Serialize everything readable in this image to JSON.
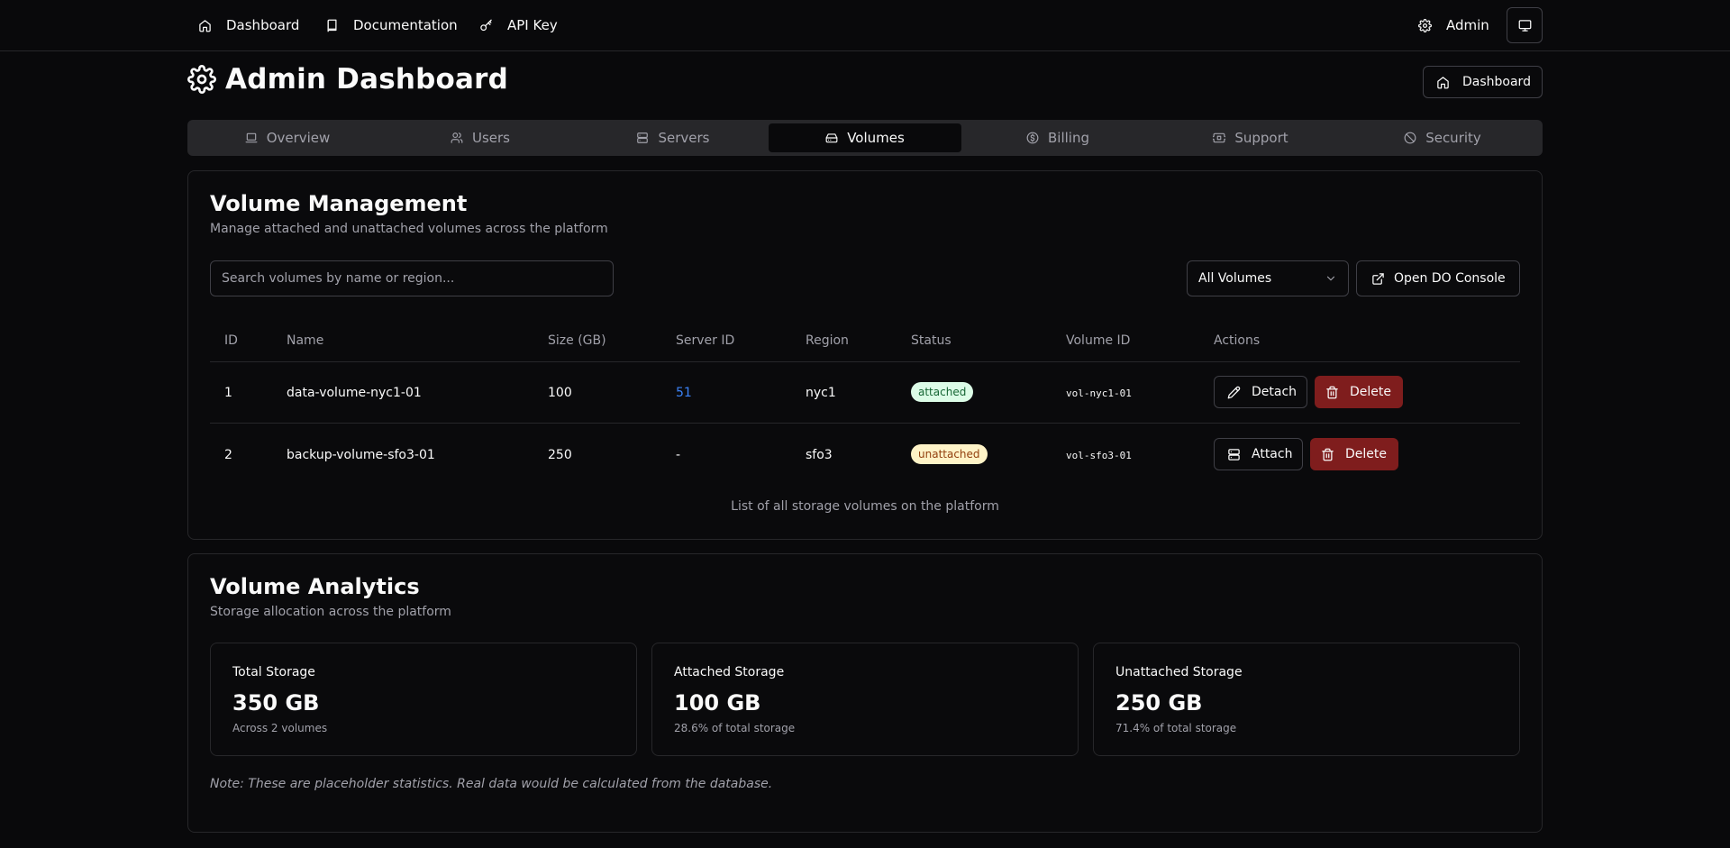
{
  "topnav": {
    "dashboard": "Dashboard",
    "documentation": "Documentation",
    "api_key": "API Key",
    "admin": "Admin"
  },
  "header": {
    "title": "Admin Dashboard",
    "dashboard_button": "Dashboard"
  },
  "tabs": [
    {
      "label": "Overview",
      "icon": "laptop-icon"
    },
    {
      "label": "Users",
      "icon": "users-icon"
    },
    {
      "label": "Servers",
      "icon": "server-icon"
    },
    {
      "label": "Volumes",
      "icon": "hard-drive-icon",
      "active": true
    },
    {
      "label": "Billing",
      "icon": "dollar-circle-icon"
    },
    {
      "label": "Support",
      "icon": "ticket-icon"
    },
    {
      "label": "Security",
      "icon": "ban-icon"
    }
  ],
  "volumes": {
    "title": "Volume Management",
    "subtitle": "Manage attached and unattached volumes across the platform",
    "search_placeholder": "Search volumes by name or region...",
    "filter_value": "All Volumes",
    "console_button": "Open DO Console",
    "columns": [
      "ID",
      "Name",
      "Size (GB)",
      "Server ID",
      "Region",
      "Status",
      "Volume ID",
      "Actions"
    ],
    "rows": [
      {
        "id": "1",
        "name": "data-volume-nyc1-01",
        "size": "100",
        "server_id": "51",
        "region": "nyc1",
        "status": "attached",
        "volume_id": "vol-nyc1-01",
        "action": "Detach",
        "delete": "Delete"
      },
      {
        "id": "2",
        "name": "backup-volume-sfo3-01",
        "size": "250",
        "server_id": "-",
        "region": "sfo3",
        "status": "unattached",
        "volume_id": "vol-sfo3-01",
        "action": "Attach",
        "delete": "Delete"
      }
    ],
    "caption": "List of all storage volumes on the platform"
  },
  "analytics": {
    "title": "Volume Analytics",
    "subtitle": "Storage allocation across the platform",
    "stats": [
      {
        "label": "Total Storage",
        "value": "350 GB",
        "note": "Across 2 volumes"
      },
      {
        "label": "Attached Storage",
        "value": "100 GB",
        "note": "28.6% of total storage"
      },
      {
        "label": "Unattached Storage",
        "value": "250 GB",
        "note": "71.4% of total storage"
      }
    ],
    "note": "Note: These are placeholder statistics. Real data would be calculated from the database."
  },
  "colors": {
    "background": "#09090b",
    "border": "#27272a",
    "link": "#3b82f6",
    "danger": "#7f1d1d",
    "attached_badge": "#dcfce7",
    "unattached_badge": "#fef3c7"
  }
}
